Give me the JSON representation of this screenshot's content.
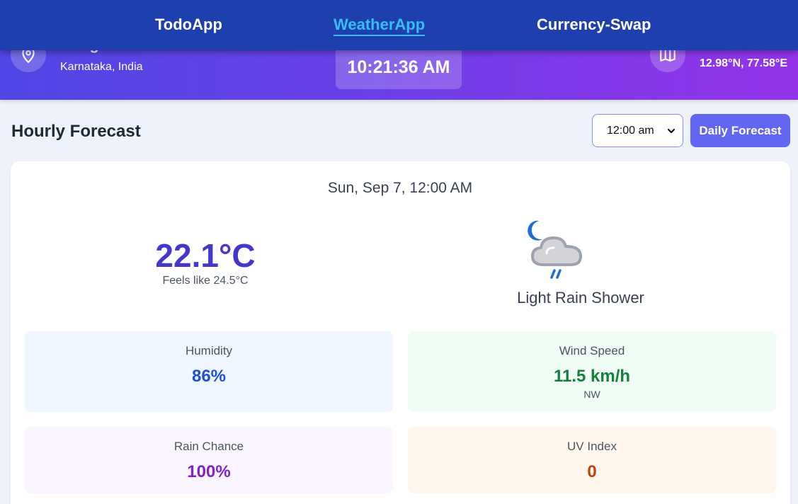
{
  "nav": {
    "links": [
      "TodoApp",
      "WeatherApp",
      "Currency-Swap"
    ],
    "active": "WeatherApp"
  },
  "location": {
    "city": "Bengaluru",
    "region": "Karnataka, India",
    "coordinates": "12.98°N, 77.58°E",
    "current_time": "10:21:36 AM"
  },
  "forecast": {
    "title": "Hourly Forecast",
    "selected_time": "12:00 am",
    "daily_button": "Daily Forecast",
    "date": "Sun, Sep 7, 12:00 AM",
    "temperature": "22.1°C",
    "feels_like": "Feels like 24.5°C",
    "condition": "Light Rain Shower",
    "condition_icon": "night-rain-cloud-icon"
  },
  "stats": {
    "humidity": {
      "label": "Humidity",
      "value": "86%"
    },
    "wind": {
      "label": "Wind Speed",
      "value": "11.5 km/h",
      "direction": "NW"
    },
    "rain": {
      "label": "Rain Chance",
      "value": "100%"
    },
    "uv": {
      "label": "UV Index",
      "value": "0"
    }
  },
  "colors": {
    "nav_bg": "#1e40af",
    "nav_active": "#38bdf8",
    "accent": "#6366f1",
    "humidity": "#1d4ed8",
    "wind": "#15803d",
    "rain": "#7e22ce",
    "uv": "#c2410c"
  }
}
